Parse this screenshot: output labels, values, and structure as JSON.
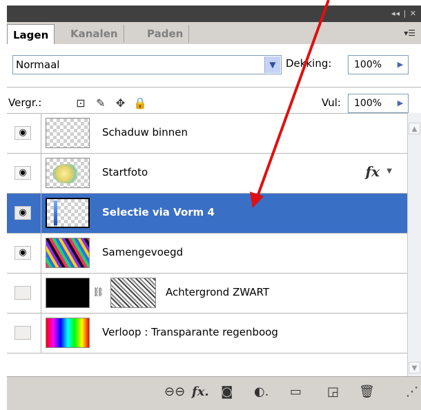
{
  "panel": {
    "title_controls": "◂◂ | ✕",
    "tabs": [
      {
        "label": "Lagen",
        "active": true
      },
      {
        "label": "Kanalen",
        "active": false
      },
      {
        "label": "Paden",
        "active": false
      }
    ],
    "menu_icon": "panel-menu-icon"
  },
  "controls": {
    "blend_mode": "Normaal",
    "opacity_label": "Dekking:",
    "opacity_value": "100%",
    "lock_label": "Vergr.:",
    "fill_label": "Vul:",
    "fill_value": "100%",
    "lock_icons": [
      "lock-transparent-icon",
      "lock-paint-icon",
      "lock-position-icon",
      "lock-all-icon"
    ]
  },
  "layers": [
    {
      "name": "Schaduw binnen",
      "visible": true,
      "selected": false,
      "thumb": "transparent"
    },
    {
      "name": "Startfoto",
      "visible": true,
      "selected": false,
      "thumb": "photo",
      "fx": "fx"
    },
    {
      "name": "Selectie via Vorm 4",
      "visible": true,
      "selected": true,
      "thumb": "selection"
    },
    {
      "name": "Samengevoegd",
      "visible": true,
      "selected": false,
      "thumb": "rainbow-streaks"
    },
    {
      "name": "Achtergrond ZWART",
      "visible": false,
      "selected": false,
      "thumb": "black",
      "mask": true
    },
    {
      "name": "Verloop : Transparante regenboog",
      "visible": false,
      "selected": false,
      "thumb": "rainbow-gradient"
    }
  ],
  "bottom_icons": [
    "link-layers-icon",
    "fx-icon",
    "add-mask-icon",
    "adjustment-layer-icon",
    "new-group-icon",
    "new-layer-icon",
    "trash-icon"
  ],
  "colors": {
    "selection": "#3a6fc6",
    "arrow": "#e01010",
    "panel_bg": "#d6d3ce"
  }
}
